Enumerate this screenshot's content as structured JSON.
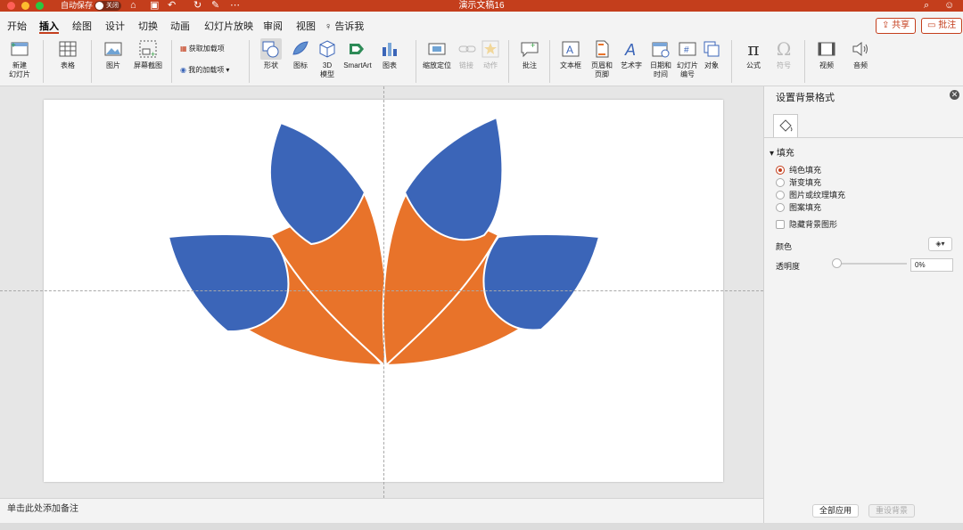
{
  "app": {
    "title": "演示文稿16",
    "autosave_label": "自动保存",
    "autosave_state": "关闭"
  },
  "tabs": [
    "开始",
    "插入",
    "绘图",
    "设计",
    "切换",
    "动画",
    "幻灯片放映",
    "审阅",
    "视图",
    "告诉我"
  ],
  "active_tab": "插入",
  "header_buttons": {
    "share": "共享",
    "comments": "批注"
  },
  "ribbon": {
    "new_slide": "新建\n幻灯片",
    "table": "表格",
    "picture": "图片",
    "screenshot": "屏幕截图",
    "get_addins": "获取加载项",
    "my_addins": "我的加载项",
    "shapes": "形状",
    "icons": "图标",
    "model3d": "3D\n模型",
    "smartart": "SmartArt",
    "chart": "图表",
    "zoom": "缩放定位",
    "link": "链接",
    "action": "动作",
    "comment": "批注",
    "textbox": "文本框",
    "header_footer": "页眉和\n页脚",
    "wordart": "艺术字",
    "datetime": "日期和\n时间",
    "slide_number": "幻灯片\n编号",
    "object": "对象",
    "equation": "公式",
    "symbol": "符号",
    "video": "视频",
    "audio": "音频"
  },
  "notes_placeholder": "单击此处添加备注",
  "panel": {
    "title": "设置背景格式",
    "section": "填充",
    "options": [
      "纯色填充",
      "渐变填充",
      "图片或纹理填充",
      "图案填充"
    ],
    "selected_option": "纯色填充",
    "hide_bg_graphics": "隐藏背景图形",
    "color_label": "颜色",
    "transparency_label": "透明度",
    "transparency_value": "0%",
    "apply_all": "全部应用",
    "reset_bg": "重设背景"
  },
  "colors": {
    "accent": "#c43e1c",
    "petal_blue": "#3b65b8",
    "petal_orange": "#e8732a"
  }
}
